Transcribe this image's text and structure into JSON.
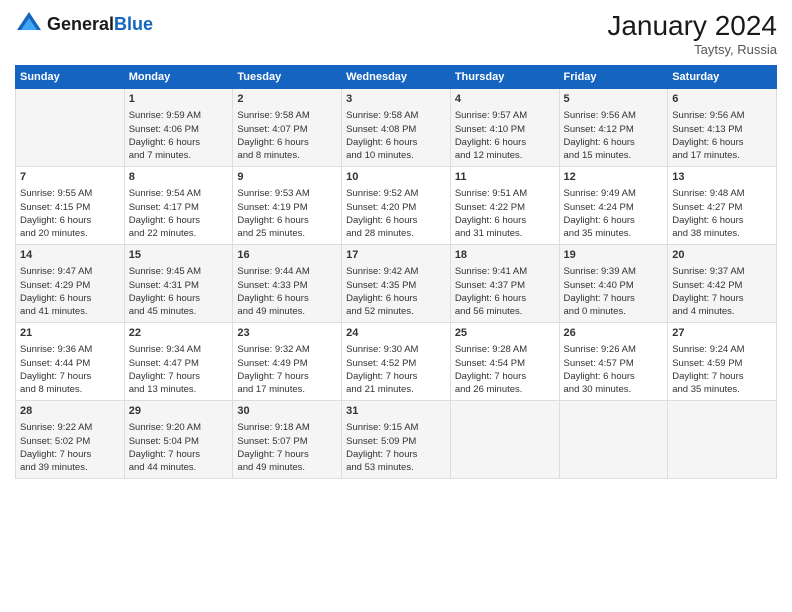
{
  "header": {
    "logo_general": "General",
    "logo_blue": "Blue",
    "month_title": "January 2024",
    "location": "Taytsy, Russia"
  },
  "columns": [
    "Sunday",
    "Monday",
    "Tuesday",
    "Wednesday",
    "Thursday",
    "Friday",
    "Saturday"
  ],
  "weeks": [
    [
      {
        "day": "",
        "info": ""
      },
      {
        "day": "1",
        "info": "Sunrise: 9:59 AM\nSunset: 4:06 PM\nDaylight: 6 hours\nand 7 minutes."
      },
      {
        "day": "2",
        "info": "Sunrise: 9:58 AM\nSunset: 4:07 PM\nDaylight: 6 hours\nand 8 minutes."
      },
      {
        "day": "3",
        "info": "Sunrise: 9:58 AM\nSunset: 4:08 PM\nDaylight: 6 hours\nand 10 minutes."
      },
      {
        "day": "4",
        "info": "Sunrise: 9:57 AM\nSunset: 4:10 PM\nDaylight: 6 hours\nand 12 minutes."
      },
      {
        "day": "5",
        "info": "Sunrise: 9:56 AM\nSunset: 4:12 PM\nDaylight: 6 hours\nand 15 minutes."
      },
      {
        "day": "6",
        "info": "Sunrise: 9:56 AM\nSunset: 4:13 PM\nDaylight: 6 hours\nand 17 minutes."
      }
    ],
    [
      {
        "day": "7",
        "info": "Sunrise: 9:55 AM\nSunset: 4:15 PM\nDaylight: 6 hours\nand 20 minutes."
      },
      {
        "day": "8",
        "info": "Sunrise: 9:54 AM\nSunset: 4:17 PM\nDaylight: 6 hours\nand 22 minutes."
      },
      {
        "day": "9",
        "info": "Sunrise: 9:53 AM\nSunset: 4:19 PM\nDaylight: 6 hours\nand 25 minutes."
      },
      {
        "day": "10",
        "info": "Sunrise: 9:52 AM\nSunset: 4:20 PM\nDaylight: 6 hours\nand 28 minutes."
      },
      {
        "day": "11",
        "info": "Sunrise: 9:51 AM\nSunset: 4:22 PM\nDaylight: 6 hours\nand 31 minutes."
      },
      {
        "day": "12",
        "info": "Sunrise: 9:49 AM\nSunset: 4:24 PM\nDaylight: 6 hours\nand 35 minutes."
      },
      {
        "day": "13",
        "info": "Sunrise: 9:48 AM\nSunset: 4:27 PM\nDaylight: 6 hours\nand 38 minutes."
      }
    ],
    [
      {
        "day": "14",
        "info": "Sunrise: 9:47 AM\nSunset: 4:29 PM\nDaylight: 6 hours\nand 41 minutes."
      },
      {
        "day": "15",
        "info": "Sunrise: 9:45 AM\nSunset: 4:31 PM\nDaylight: 6 hours\nand 45 minutes."
      },
      {
        "day": "16",
        "info": "Sunrise: 9:44 AM\nSunset: 4:33 PM\nDaylight: 6 hours\nand 49 minutes."
      },
      {
        "day": "17",
        "info": "Sunrise: 9:42 AM\nSunset: 4:35 PM\nDaylight: 6 hours\nand 52 minutes."
      },
      {
        "day": "18",
        "info": "Sunrise: 9:41 AM\nSunset: 4:37 PM\nDaylight: 6 hours\nand 56 minutes."
      },
      {
        "day": "19",
        "info": "Sunrise: 9:39 AM\nSunset: 4:40 PM\nDaylight: 7 hours\nand 0 minutes."
      },
      {
        "day": "20",
        "info": "Sunrise: 9:37 AM\nSunset: 4:42 PM\nDaylight: 7 hours\nand 4 minutes."
      }
    ],
    [
      {
        "day": "21",
        "info": "Sunrise: 9:36 AM\nSunset: 4:44 PM\nDaylight: 7 hours\nand 8 minutes."
      },
      {
        "day": "22",
        "info": "Sunrise: 9:34 AM\nSunset: 4:47 PM\nDaylight: 7 hours\nand 13 minutes."
      },
      {
        "day": "23",
        "info": "Sunrise: 9:32 AM\nSunset: 4:49 PM\nDaylight: 7 hours\nand 17 minutes."
      },
      {
        "day": "24",
        "info": "Sunrise: 9:30 AM\nSunset: 4:52 PM\nDaylight: 7 hours\nand 21 minutes."
      },
      {
        "day": "25",
        "info": "Sunrise: 9:28 AM\nSunset: 4:54 PM\nDaylight: 7 hours\nand 26 minutes."
      },
      {
        "day": "26",
        "info": "Sunrise: 9:26 AM\nSunset: 4:57 PM\nDaylight: 6 hours\nand 30 minutes."
      },
      {
        "day": "27",
        "info": "Sunrise: 9:24 AM\nSunset: 4:59 PM\nDaylight: 7 hours\nand 35 minutes."
      }
    ],
    [
      {
        "day": "28",
        "info": "Sunrise: 9:22 AM\nSunset: 5:02 PM\nDaylight: 7 hours\nand 39 minutes."
      },
      {
        "day": "29",
        "info": "Sunrise: 9:20 AM\nSunset: 5:04 PM\nDaylight: 7 hours\nand 44 minutes."
      },
      {
        "day": "30",
        "info": "Sunrise: 9:18 AM\nSunset: 5:07 PM\nDaylight: 7 hours\nand 49 minutes."
      },
      {
        "day": "31",
        "info": "Sunrise: 9:15 AM\nSunset: 5:09 PM\nDaylight: 7 hours\nand 53 minutes."
      },
      {
        "day": "",
        "info": ""
      },
      {
        "day": "",
        "info": ""
      },
      {
        "day": "",
        "info": ""
      }
    ]
  ]
}
